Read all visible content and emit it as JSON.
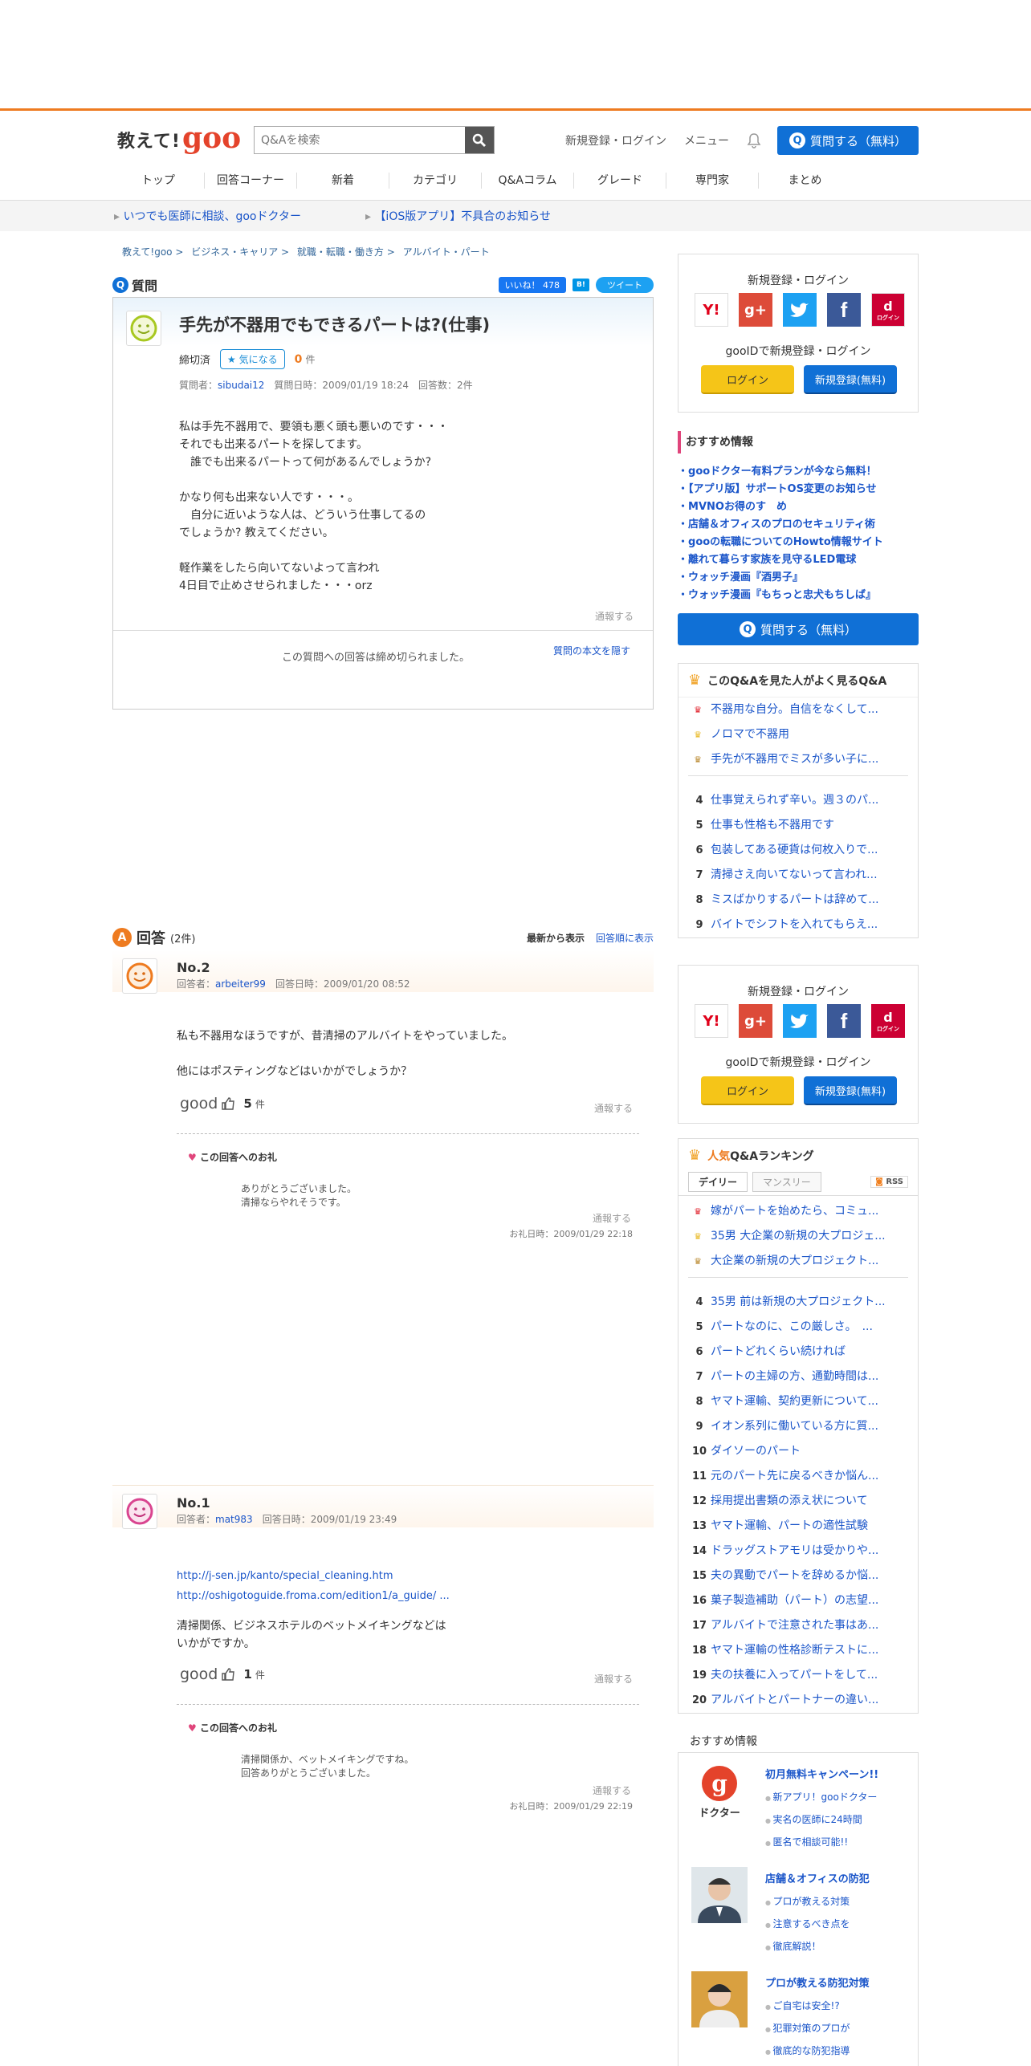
{
  "header": {
    "logo_text": "教えて!",
    "logo_brand": "goo",
    "search_placeholder": "Q&Aを検索",
    "login_link": "新規登録・ログイン",
    "menu_link": "メニュー",
    "ask_button": "質問する（無料）"
  },
  "nav": [
    "トップ",
    "回答コーナー",
    "新着",
    "カテゴリ",
    "Q&Aコラム",
    "グレード",
    "専門家",
    "まとめ"
  ],
  "notices": [
    "いつでも医師に相談、gooドクター",
    "【iOS版アプリ】不具合のお知らせ"
  ],
  "breadcrumb": [
    "教えて!goo >",
    "ビジネス・キャリア >",
    "就職・転職・働き方 >",
    "アルバイト・パート"
  ],
  "question": {
    "label": "質問",
    "like": "いいね！ 478",
    "hatena": "B!",
    "tweet": "ツイート",
    "title": "手先が不器用でもできるパートは?(仕事)",
    "status": "締切済",
    "watch_button": "気になる",
    "watch_count": "0",
    "watch_unit": "件",
    "meta_prefix": "質問者：",
    "author": "sibudai12",
    "meta_suffix": "質問日時：2009/01/19 18:24　回答数：2件",
    "body": "私は手先不器用で、要領も悪く頭も悪いのです・・・\nそれでも出来るパートを探してます。\n　誰でも出来るパートって何があるんでしょうか?\n\nかなり何も出来ない人です・・・。\n　自分に近いような人は、どういう仕事してるの\nでしょうか? 教えてください。\n\n軽作業をしたら向いてないよって言われ\n4日目で止めさせられました・・・orz",
    "report": "通報する",
    "closed_note": "この質問への回答は締め切られました。",
    "quote_link": "質問の本文を隠す"
  },
  "answers_header": {
    "label": "回答",
    "count": "(2件)",
    "sort_new": "最新から表示",
    "sort_order": "回答順に表示"
  },
  "answers": [
    {
      "no": "No.2",
      "meta_prefix": "回答者：",
      "author": "arbeiter99",
      "meta_suffix": "回答日時：2009/01/20 08:52",
      "body": "私も不器用なほうですが、昔清掃のアルバイトをやっていました。\n\n他にはポスティングなどはいかがでしょうか？",
      "good_label": "good",
      "good_count": "5",
      "good_unit": "件",
      "report": "通報する",
      "thanks_label": "この回答へのお礼",
      "thanks_body": "ありがとうございました。\n清掃ならやれそうです。",
      "thanks_report": "通報する",
      "thanks_date": "お礼日時：2009/01/29 22:18"
    },
    {
      "no": "No.1",
      "meta_prefix": "回答者：",
      "author": "mat983",
      "meta_suffix": "回答日時：2009/01/19 23:49",
      "link1": "http://j-sen.jp/kanto/special_cleaning.htm",
      "link2": "http://oshigotoguide.froma.com/edition1/a_guide/ ...",
      "body": "清掃関係、ビジネスホテルのベットメイキングなどは\nいかがですか。",
      "good_label": "good",
      "good_count": "1",
      "good_unit": "件",
      "report": "通報する",
      "thanks_label": "この回答へのお礼",
      "thanks_body": "清掃関係か、ベットメイキングですね。\n回答ありがとうございました。",
      "thanks_report": "通報する",
      "thanks_date": "お礼日時：2009/01/29 22:19"
    }
  ],
  "login_box": {
    "title": "新規登録・ログイン",
    "sns": [
      "Y!",
      "g+",
      "t",
      "f",
      "d"
    ],
    "sns_d_sub": "ログイン",
    "gooid": "gooIDで新規登録・ログイン",
    "login": "ログイン",
    "register": "新規登録(無料)"
  },
  "recommend": {
    "title": "おすすめ情報",
    "items": [
      "gooドクター有料プランが今なら無料！",
      "【アプリ版】サポートOS変更のお知らせ",
      "MVNOお得のす　め",
      "店舗＆オフィスのプロのセキュリティ術",
      "gooの転職についてのHowto情報サイト",
      "離れて暮らす家族を見守るLED電球",
      "ウォッチ漫画『酒男子』",
      "ウォッチ漫画『もちっと忠犬もちしば』"
    ],
    "ask_button": "質問する（無料）"
  },
  "related": {
    "title": "このQ&Aを見た人がよく見るQ&A",
    "items": [
      "不器用な自分。自信をなくして...",
      "ノロマで不器用",
      "手先が不器用でミスが多い子に...",
      "仕事覚えられず辛い。週３のパ...",
      "仕事も性格も不器用です",
      "包装してある硬貨は何枚入りで...",
      "清掃さえ向いてないって言われ...",
      "ミスばかりするパートは辞めて...",
      "バイトでシフトを入れてもらえ..."
    ]
  },
  "ranking": {
    "title_hi": "人気",
    "title": "Q&Aランキング",
    "tab_daily": "デイリー",
    "tab_monthly": "マンスリー",
    "rss": "RSS",
    "items": [
      "嫁がパートを始めたら、コミュ...",
      "35男 大企業の新規の大プロジェ...",
      "大企業の新規の大プロジェクト...",
      "35男 前は新規の大プロジェクト...",
      "パートなのに、この厳しさ。　...",
      "パートどれくらい続ければ",
      "パートの主婦の方、通勤時間は...",
      "ヤマト運輸、契約更新について...",
      "イオン系列に働いている方に質...",
      "ダイソーのパート",
      "元のパート先に戻るべきか悩ん...",
      "採用提出書類の添え状について",
      "ヤマト運輸、パートの適性試験",
      "ドラッグストアモリは受かりや...",
      "夫の異動でパートを辞めるか悩...",
      "菓子製造補助（パート）の志望...",
      "アルバイトで注意された事はあ...",
      "ヤマト運輸の性格診断テストに...",
      "夫の扶養に入ってパートをして...",
      "アルバイトとパートナーの違い..."
    ]
  },
  "promo": {
    "title": "おすすめ情報",
    "items": [
      {
        "title": "初月無料キャンペーン!!",
        "img_label": "ドクター",
        "lines": [
          "新アプリ！gooドクター",
          "実名の医師に24時間",
          "匿名で相談可能!!"
        ]
      },
      {
        "title": "店舗＆オフィスの防犯",
        "lines": [
          "プロが教える対策",
          "注意するべき点を",
          "徹底解説！"
        ]
      },
      {
        "title": "プロが教える防犯対策",
        "lines": [
          "ご自宅は安全!?",
          "犯罪対策のプロが",
          "徹底的な防犯指導"
        ]
      }
    ]
  },
  "colors": {
    "accent": "#ee7b20",
    "primary": "#1070d6",
    "link": "#1a55c9"
  }
}
